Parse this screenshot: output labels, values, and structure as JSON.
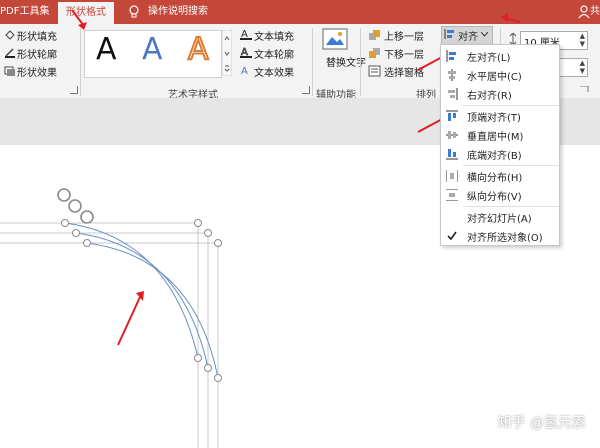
{
  "tabs": {
    "pdf_tools": "PDF工具集",
    "shape_format": "形状格式",
    "tell_me": "操作说明搜索",
    "share": "共"
  },
  "shape_styles": {
    "fill": "形状填充",
    "outline": "形状轮廓",
    "effects": "形状效果"
  },
  "wordart": {
    "sample_letter": "A",
    "text_fill": "文本填充",
    "text_outline": "文本轮廓",
    "text_effects": "文本效果",
    "group_label": "艺术字样式"
  },
  "accessibility": {
    "alt_text": "替换文字",
    "group_label": "辅助功能"
  },
  "arrange": {
    "bring_forward": "上移一层",
    "send_backward": "下移一层",
    "selection_pane": "选择窗格",
    "align": "对齐",
    "group_label": "排列"
  },
  "size": {
    "height_value": "10 厘米"
  },
  "align_menu": {
    "items": [
      "左对齐(L)",
      "水平居中(C)",
      "右对齐(R)",
      "顶端对齐(T)",
      "垂直居中(M)",
      "底端对齐(B)",
      "横向分布(H)",
      "纵向分布(V)",
      "对齐幻灯片(A)",
      "对齐所选对象(O)"
    ]
  },
  "watermark": "知乎 @氢元素",
  "colors": {
    "accent": "#c4483a",
    "arrow_red": "#e02020",
    "curve_blue": "#6b8fc4"
  }
}
